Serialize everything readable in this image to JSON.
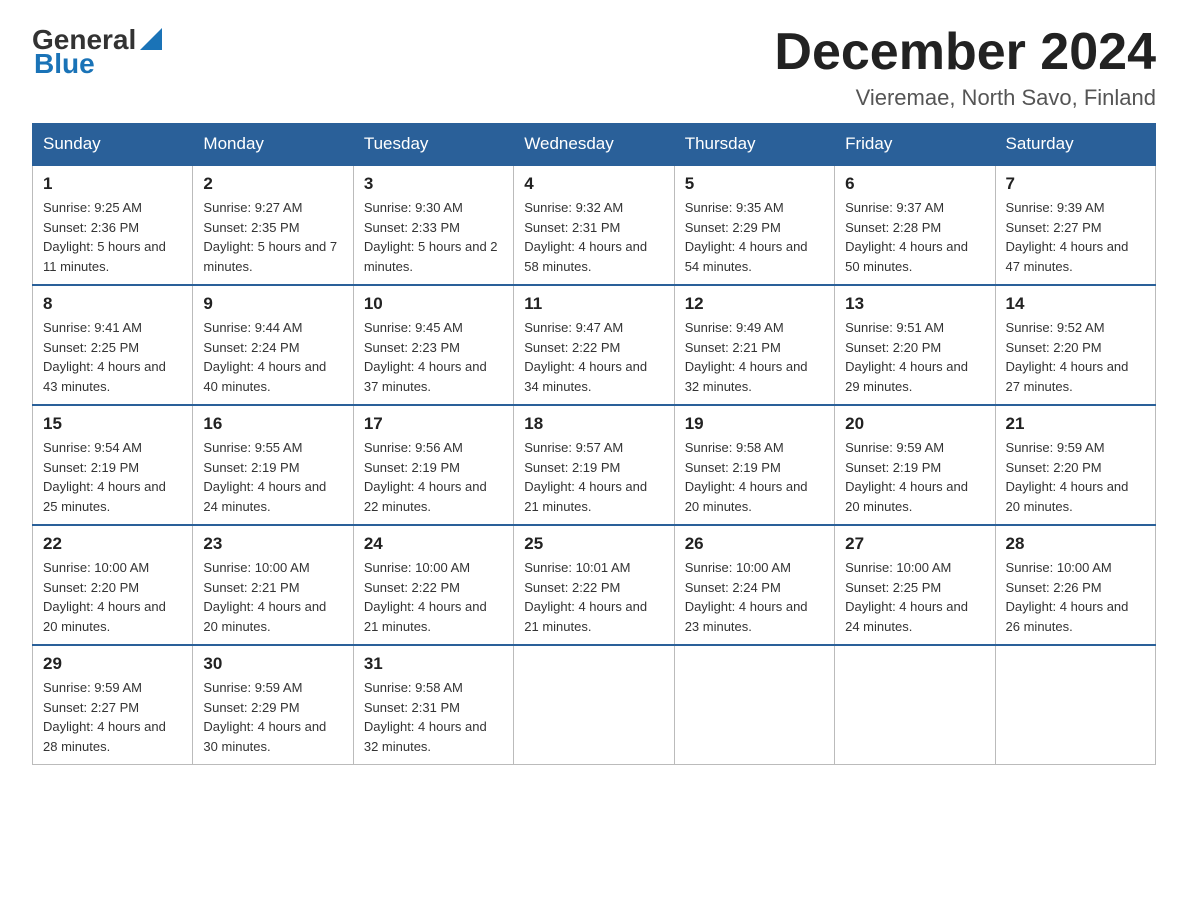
{
  "header": {
    "logo_general": "General",
    "logo_blue": "Blue",
    "title": "December 2024",
    "subtitle": "Vieremae, North Savo, Finland"
  },
  "weekdays": [
    "Sunday",
    "Monday",
    "Tuesday",
    "Wednesday",
    "Thursday",
    "Friday",
    "Saturday"
  ],
  "weeks": [
    [
      {
        "day": "1",
        "sunrise": "9:25 AM",
        "sunset": "2:36 PM",
        "daylight": "5 hours and 11 minutes."
      },
      {
        "day": "2",
        "sunrise": "9:27 AM",
        "sunset": "2:35 PM",
        "daylight": "5 hours and 7 minutes."
      },
      {
        "day": "3",
        "sunrise": "9:30 AM",
        "sunset": "2:33 PM",
        "daylight": "5 hours and 2 minutes."
      },
      {
        "day": "4",
        "sunrise": "9:32 AM",
        "sunset": "2:31 PM",
        "daylight": "4 hours and 58 minutes."
      },
      {
        "day": "5",
        "sunrise": "9:35 AM",
        "sunset": "2:29 PM",
        "daylight": "4 hours and 54 minutes."
      },
      {
        "day": "6",
        "sunrise": "9:37 AM",
        "sunset": "2:28 PM",
        "daylight": "4 hours and 50 minutes."
      },
      {
        "day": "7",
        "sunrise": "9:39 AM",
        "sunset": "2:27 PM",
        "daylight": "4 hours and 47 minutes."
      }
    ],
    [
      {
        "day": "8",
        "sunrise": "9:41 AM",
        "sunset": "2:25 PM",
        "daylight": "4 hours and 43 minutes."
      },
      {
        "day": "9",
        "sunrise": "9:44 AM",
        "sunset": "2:24 PM",
        "daylight": "4 hours and 40 minutes."
      },
      {
        "day": "10",
        "sunrise": "9:45 AM",
        "sunset": "2:23 PM",
        "daylight": "4 hours and 37 minutes."
      },
      {
        "day": "11",
        "sunrise": "9:47 AM",
        "sunset": "2:22 PM",
        "daylight": "4 hours and 34 minutes."
      },
      {
        "day": "12",
        "sunrise": "9:49 AM",
        "sunset": "2:21 PM",
        "daylight": "4 hours and 32 minutes."
      },
      {
        "day": "13",
        "sunrise": "9:51 AM",
        "sunset": "2:20 PM",
        "daylight": "4 hours and 29 minutes."
      },
      {
        "day": "14",
        "sunrise": "9:52 AM",
        "sunset": "2:20 PM",
        "daylight": "4 hours and 27 minutes."
      }
    ],
    [
      {
        "day": "15",
        "sunrise": "9:54 AM",
        "sunset": "2:19 PM",
        "daylight": "4 hours and 25 minutes."
      },
      {
        "day": "16",
        "sunrise": "9:55 AM",
        "sunset": "2:19 PM",
        "daylight": "4 hours and 24 minutes."
      },
      {
        "day": "17",
        "sunrise": "9:56 AM",
        "sunset": "2:19 PM",
        "daylight": "4 hours and 22 minutes."
      },
      {
        "day": "18",
        "sunrise": "9:57 AM",
        "sunset": "2:19 PM",
        "daylight": "4 hours and 21 minutes."
      },
      {
        "day": "19",
        "sunrise": "9:58 AM",
        "sunset": "2:19 PM",
        "daylight": "4 hours and 20 minutes."
      },
      {
        "day": "20",
        "sunrise": "9:59 AM",
        "sunset": "2:19 PM",
        "daylight": "4 hours and 20 minutes."
      },
      {
        "day": "21",
        "sunrise": "9:59 AM",
        "sunset": "2:20 PM",
        "daylight": "4 hours and 20 minutes."
      }
    ],
    [
      {
        "day": "22",
        "sunrise": "10:00 AM",
        "sunset": "2:20 PM",
        "daylight": "4 hours and 20 minutes."
      },
      {
        "day": "23",
        "sunrise": "10:00 AM",
        "sunset": "2:21 PM",
        "daylight": "4 hours and 20 minutes."
      },
      {
        "day": "24",
        "sunrise": "10:00 AM",
        "sunset": "2:22 PM",
        "daylight": "4 hours and 21 minutes."
      },
      {
        "day": "25",
        "sunrise": "10:01 AM",
        "sunset": "2:22 PM",
        "daylight": "4 hours and 21 minutes."
      },
      {
        "day": "26",
        "sunrise": "10:00 AM",
        "sunset": "2:24 PM",
        "daylight": "4 hours and 23 minutes."
      },
      {
        "day": "27",
        "sunrise": "10:00 AM",
        "sunset": "2:25 PM",
        "daylight": "4 hours and 24 minutes."
      },
      {
        "day": "28",
        "sunrise": "10:00 AM",
        "sunset": "2:26 PM",
        "daylight": "4 hours and 26 minutes."
      }
    ],
    [
      {
        "day": "29",
        "sunrise": "9:59 AM",
        "sunset": "2:27 PM",
        "daylight": "4 hours and 28 minutes."
      },
      {
        "day": "30",
        "sunrise": "9:59 AM",
        "sunset": "2:29 PM",
        "daylight": "4 hours and 30 minutes."
      },
      {
        "day": "31",
        "sunrise": "9:58 AM",
        "sunset": "2:31 PM",
        "daylight": "4 hours and 32 minutes."
      },
      null,
      null,
      null,
      null
    ]
  ]
}
